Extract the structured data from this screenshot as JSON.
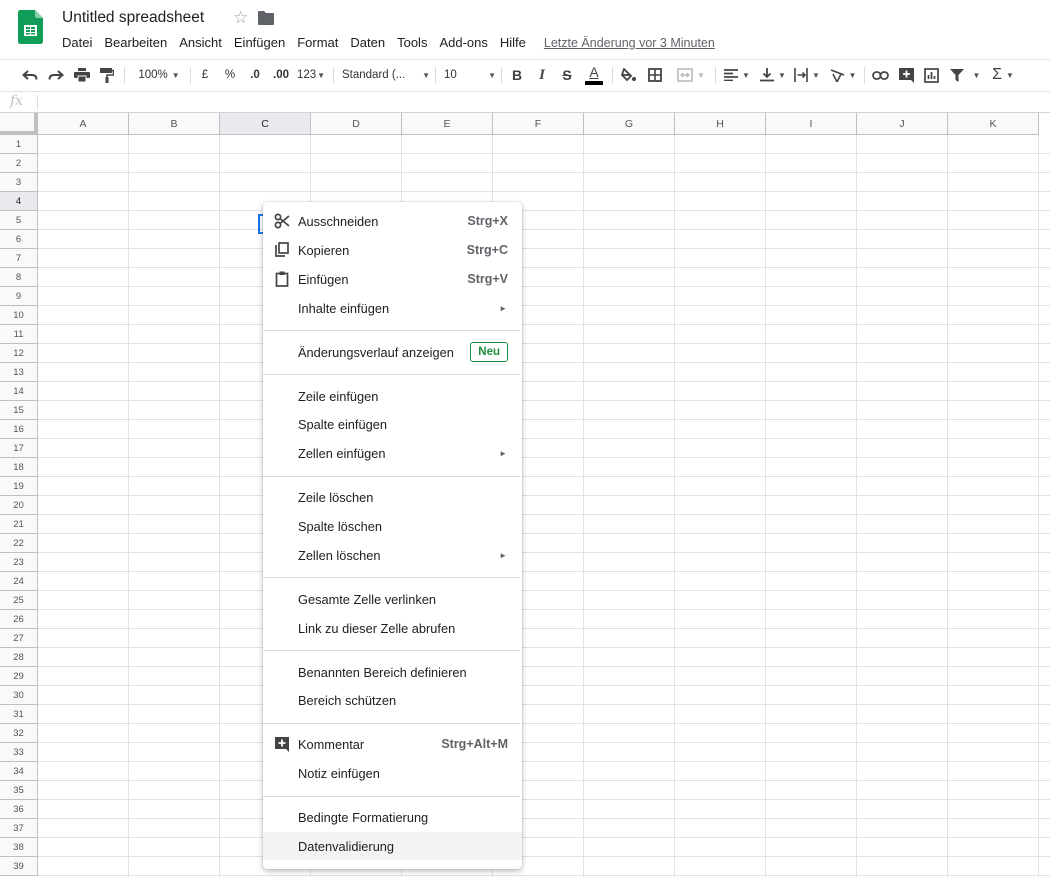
{
  "app": {
    "doc_title": "Untitled spreadsheet",
    "last_edit": "Letzte Änderung vor 3 Minuten"
  },
  "menubar": [
    "Datei",
    "Bearbeiten",
    "Ansicht",
    "Einfügen",
    "Format",
    "Daten",
    "Tools",
    "Add-ons",
    "Hilfe"
  ],
  "toolbar": {
    "zoom": "100%",
    "currency": "£",
    "percent": "%",
    "decimal_decrease": ".0",
    "decimal_increase": ".00",
    "number_format": "123",
    "font": "Standard (...",
    "font_size": "10",
    "bold": "B",
    "italic": "I",
    "strikethrough": "S",
    "text_color": "A",
    "text_color_value": "#000000",
    "sum": "Σ"
  },
  "formula_bar": {
    "fx": "fx"
  },
  "grid": {
    "columns": [
      "A",
      "B",
      "C",
      "D",
      "E",
      "F",
      "G",
      "H",
      "I",
      "J",
      "K"
    ],
    "rows": [
      "1",
      "2",
      "3",
      "4",
      "5",
      "6",
      "7",
      "8",
      "9",
      "10",
      "11",
      "12",
      "13",
      "14",
      "15",
      "16",
      "17",
      "18",
      "19",
      "20",
      "21",
      "22",
      "23",
      "24",
      "25",
      "26",
      "27",
      "28",
      "29",
      "30",
      "31",
      "32",
      "33",
      "34",
      "35",
      "36",
      "37",
      "38",
      "39"
    ],
    "active_column": "C",
    "active_row": "4"
  },
  "context_menu": {
    "items": [
      {
        "label": "Ausschneiden",
        "shortcut": "Strg+X",
        "icon": "scissors-icon"
      },
      {
        "label": "Kopieren",
        "shortcut": "Strg+C",
        "icon": "copy-icon"
      },
      {
        "label": "Einfügen",
        "shortcut": "Strg+V",
        "icon": "clipboard-icon"
      },
      {
        "label": "Inhalte einfügen",
        "submenu": true
      },
      {
        "label": "Änderungsverlauf anzeigen",
        "badge": "Neu"
      },
      {
        "label": "Zeile einfügen"
      },
      {
        "label": "Spalte einfügen"
      },
      {
        "label": "Zellen einfügen",
        "submenu": true
      },
      {
        "label": "Zeile löschen"
      },
      {
        "label": "Spalte löschen"
      },
      {
        "label": "Zellen löschen",
        "submenu": true
      },
      {
        "label": "Gesamte Zelle verlinken"
      },
      {
        "label": "Link zu dieser Zelle abrufen"
      },
      {
        "label": "Benannten Bereich definieren"
      },
      {
        "label": "Bereich schützen"
      },
      {
        "label": "Kommentar",
        "shortcut": "Strg+Alt+M",
        "icon": "add-comment-icon"
      },
      {
        "label": "Notiz einfügen"
      },
      {
        "label": "Bedingte Formatierung"
      },
      {
        "label": "Datenvalidierung",
        "highlighted": true
      }
    ],
    "submenu_arrow": "►"
  },
  "colors": {
    "sheets_green": "#0f9d58",
    "selection_blue": "#1a73e8",
    "badge_green": "#1e8e3e"
  }
}
